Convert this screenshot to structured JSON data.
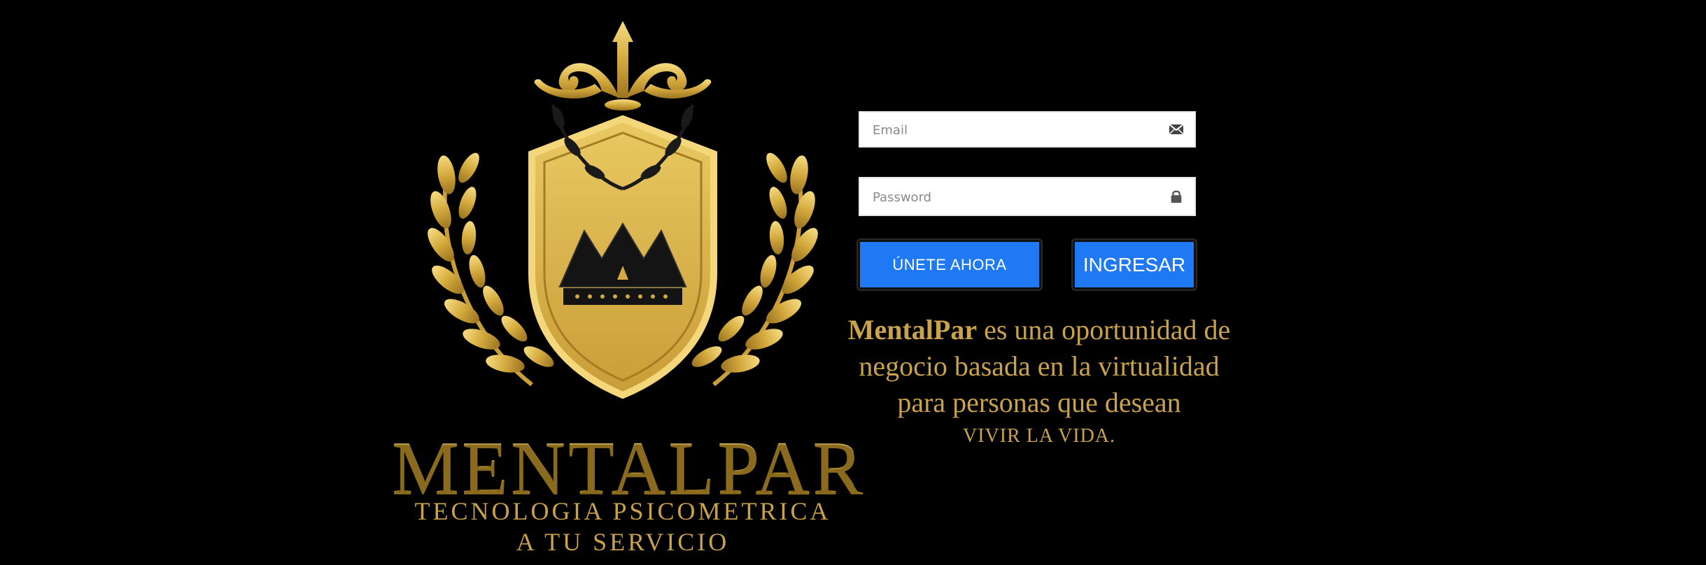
{
  "logo": {
    "brand_name": "MENTALPAR",
    "tagline_line1": "TECNOLOGIA PSICOMETRICA",
    "tagline_line2": "A TU SERVICIO"
  },
  "login_form": {
    "email": {
      "placeholder": "Email",
      "value": "",
      "icon": "envelope-icon"
    },
    "password": {
      "placeholder": "Password",
      "value": "",
      "icon": "lock-icon"
    },
    "join_button_label": "ÚNETE AHORA",
    "login_button_label": "INGRESAR"
  },
  "description": {
    "brand": "MentalPar",
    "text": " es una oportunidad de negocio basada en la virtualidad para personas que desean",
    "closing": "VIVIR LA VIDA."
  },
  "colors": {
    "background": "#000000",
    "gold": "#c9a24c",
    "button_blue": "#1f78f4"
  }
}
